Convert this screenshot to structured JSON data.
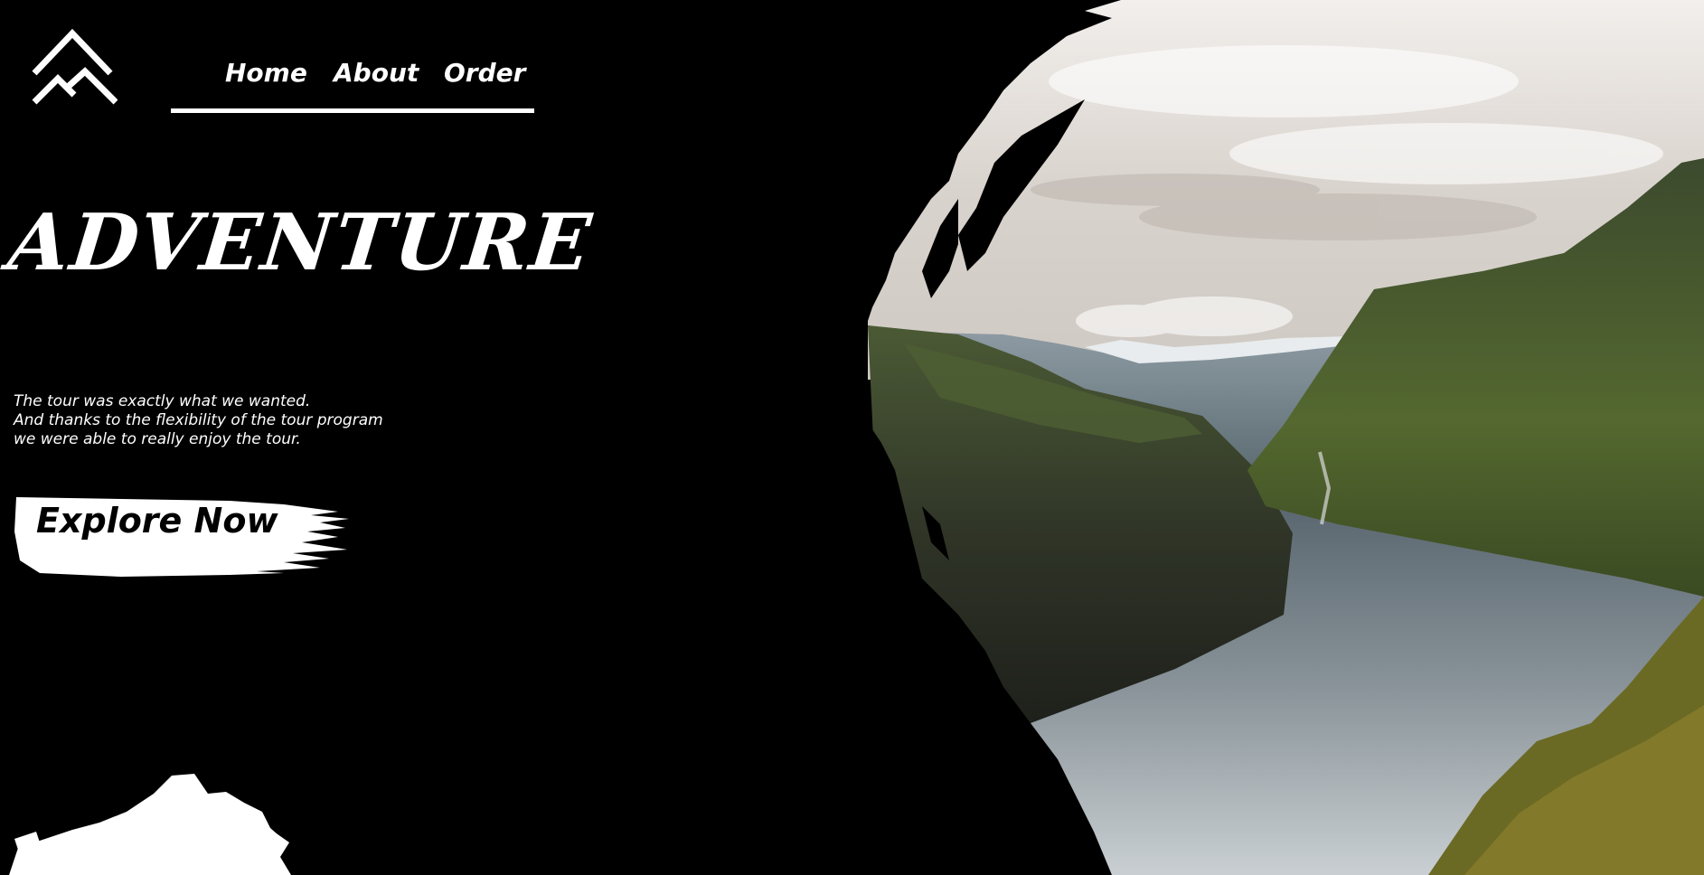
{
  "nav": {
    "items": [
      {
        "label": "Home"
      },
      {
        "label": "About"
      },
      {
        "label": "Order"
      }
    ]
  },
  "hero": {
    "title": "ADVENTURE",
    "tagline_lines": [
      "The tour was exactly what we wanted.",
      "And thanks to the flexibility of the tour program",
      "we were able to really enjoy the tour."
    ],
    "cta_label": "Explore Now"
  },
  "colors": {
    "background": "#000000",
    "text": "#ffffff",
    "cta_bg": "#ffffff",
    "cta_text": "#000000"
  },
  "icons": {
    "logo": "diamond-chevron-logo-icon"
  },
  "image": {
    "description": "Fjord landscape with cliffs, water and cloudy sky"
  }
}
